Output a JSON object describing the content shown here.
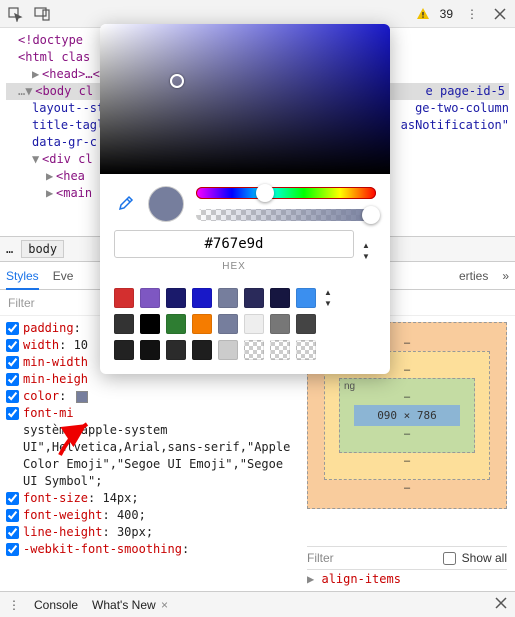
{
  "toolbar": {
    "warn_count": "39"
  },
  "dom": {
    "doctype": "<!doctype",
    "html": "<html",
    "html_attr": "clas",
    "head": "<head>…</head>",
    "body": "<body",
    "body_attr": "cl",
    "body_cls1": "e page-id-5",
    "body_cls2": "layout--st",
    "body_cls3": "ge-two-column",
    "body_cls4": "title-tagl",
    "body_cls5": "asNotification\"",
    "body_cls6": "data-gr-c",
    "div": "<div",
    "div_attr": "cl",
    "header": "<hea",
    "main": "<main"
  },
  "breadcrumb": {
    "ellipsis": "…",
    "body": "body"
  },
  "tabs": {
    "styles": "Styles",
    "events_partial": "Eve",
    "properties_partial": "erties"
  },
  "filter_label": "Filter",
  "props": {
    "p1": "padding",
    "p2": "width",
    "p2v": "10",
    "p3": "min-width",
    "p4": "min-heigh",
    "p5": "color",
    "p6": "font-",
    "font_block": "système-apple-system UI\",Helvetica,Arial,sans-serif,\"Apple Color Emoji\",\"Segoe UI Emoji\",\"Segoe UI Symbol\";",
    "p7": "font-size",
    "p7v": "14px;",
    "p8": "font-weight",
    "p8v": "400;",
    "p9": "line-height",
    "p9v": "30px;",
    "p10": "-webkit-font-smoothing"
  },
  "metrics": {
    "content": "090 × 786",
    "margin_label": "ng",
    "dash": "–"
  },
  "right": {
    "filter": "Filter",
    "show_all": "Show all",
    "align_items": "align-items"
  },
  "drawer": {
    "console": "Console",
    "whatsnew": "What's New"
  },
  "picker": {
    "hex": "#767e9d",
    "hex_label": "HEX"
  },
  "swatch_colors": [
    "#d32f2f",
    "#7e57c2",
    "#1a1a6b",
    "#1818c8",
    "#767e9d",
    "#2a2a5a",
    "#161640",
    "#3b8fef",
    "#333333",
    "#000000",
    "#2e7d32",
    "#f57c00",
    "#767e9d",
    "#eeeeee",
    "#777777",
    "#444444",
    "#222222",
    "#111111",
    "#2b2b2b",
    "#1e1e1e",
    "#cccccc",
    "#bbbbbb",
    "#aaaaaa",
    "#efefef"
  ]
}
